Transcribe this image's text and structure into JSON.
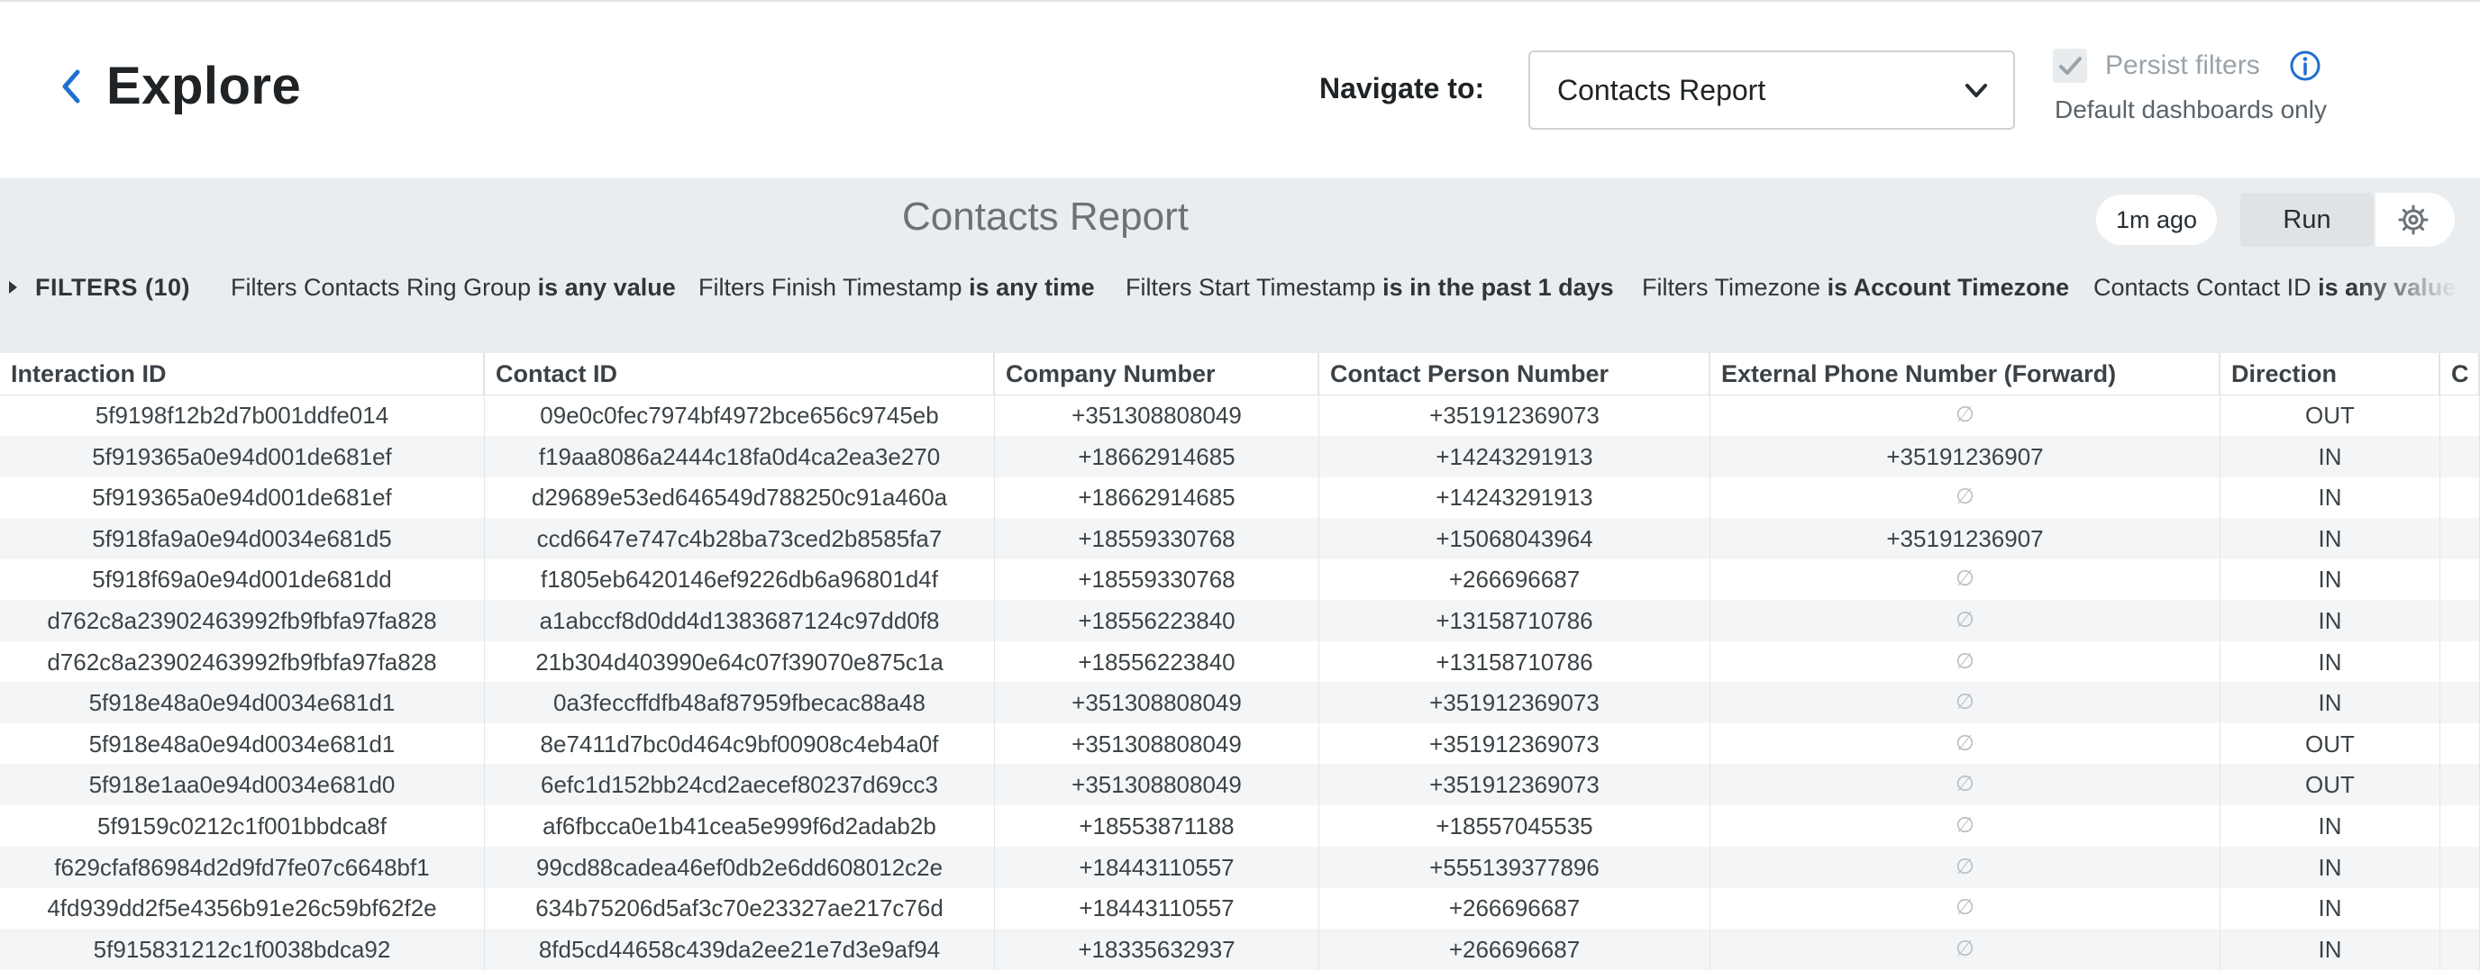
{
  "header": {
    "title": "Explore",
    "navigate_label": "Navigate to:",
    "navigate_value": "Contacts Report",
    "persist_label": "Persist filters",
    "persist_sub": "Default dashboards only"
  },
  "dashboard": {
    "title": "Contacts Report",
    "last_run": "1m ago",
    "run_label": "Run",
    "filters_label": "FILTERS (10)",
    "filters": [
      {
        "field": "Filters Contacts Ring Group",
        "value": "is any value"
      },
      {
        "field": "Filters Finish Timestamp",
        "value": "is any time"
      },
      {
        "field": "Filters Start Timestamp",
        "value": "is in the past 1 days"
      },
      {
        "field": "Filters Timezone",
        "value": "is Account Timezone"
      },
      {
        "field": "Contacts Contact ID",
        "value": "is any value"
      }
    ]
  },
  "table": {
    "columns": [
      "Interaction ID",
      "Contact ID",
      "Company Number",
      "Contact Person Number",
      "External Phone Number (Forward)",
      "Direction",
      "C"
    ],
    "null_symbol": "∅",
    "rows": [
      [
        "5f9198f12b2d7b001ddfe014",
        "09e0c0fec7974bf4972bce656c9745eb",
        "+351308808049",
        "+351912369073",
        "∅",
        "OUT"
      ],
      [
        "5f919365a0e94d001de681ef",
        "f19aa8086a2444c18fa0d4ca2ea3e270",
        "+18662914685",
        "+14243291913",
        "+35191236907",
        "IN"
      ],
      [
        "5f919365a0e94d001de681ef",
        "d29689e53ed646549d788250c91a460a",
        "+18662914685",
        "+14243291913",
        "∅",
        "IN"
      ],
      [
        "5f918fa9a0e94d0034e681d5",
        "ccd6647e747c4b28ba73ced2b8585fa7",
        "+18559330768",
        "+15068043964",
        "+35191236907",
        "IN"
      ],
      [
        "5f918f69a0e94d001de681dd",
        "f1805eb6420146ef9226db6a96801d4f",
        "+18559330768",
        "+266696687",
        "∅",
        "IN"
      ],
      [
        "d762c8a23902463992fb9fbfa97fa828",
        "a1abccf8d0dd4d1383687124c97dd0f8",
        "+18556223840",
        "+13158710786",
        "∅",
        "IN"
      ],
      [
        "d762c8a23902463992fb9fbfa97fa828",
        "21b304d403990e64c07f39070e875c1a",
        "+18556223840",
        "+13158710786",
        "∅",
        "IN"
      ],
      [
        "5f918e48a0e94d0034e681d1",
        "0a3feccffdfb48af87959fbecac88a48",
        "+351308808049",
        "+351912369073",
        "∅",
        "IN"
      ],
      [
        "5f918e48a0e94d0034e681d1",
        "8e7411d7bc0d464c9bf00908c4eb4a0f",
        "+351308808049",
        "+351912369073",
        "∅",
        "OUT"
      ],
      [
        "5f918e1aa0e94d0034e681d0",
        "6efc1d152bb24cd2aecef80237d69cc3",
        "+351308808049",
        "+351912369073",
        "∅",
        "OUT"
      ],
      [
        "5f9159c0212c1f001bbdca8f",
        "af6fbcca0e1b41cea5e999f6d2adab2b",
        "+18553871188",
        "+18557045535",
        "∅",
        "IN"
      ],
      [
        "f629cfaf86984d2d9fd7fe07c6648bf1",
        "99cd88cadea46ef0db2e6dd608012c2e",
        "+18443110557",
        "+555139377896",
        "∅",
        "IN"
      ],
      [
        "4fd939dd2f5e4356b91e26c59bf62f2e",
        "634b75206d5af3c70e23327ae217c76d",
        "+18443110557",
        "+266696687",
        "∅",
        "IN"
      ],
      [
        "5f915831212c1f0038bdca92",
        "8fd5cd44658c439da2ee21e7d3e9af94",
        "+18335632937",
        "+266696687",
        "∅",
        "IN"
      ]
    ]
  },
  "colors": {
    "accent": "#1f6fd1",
    "toolbar_bg": "#eaedf0"
  },
  "icons": {
    "back": "chevron-left-icon",
    "select": "chevron-down-icon",
    "persist": "check-icon",
    "info": "info-icon",
    "settings": "gear-icon",
    "filters": "caret-right-icon"
  }
}
